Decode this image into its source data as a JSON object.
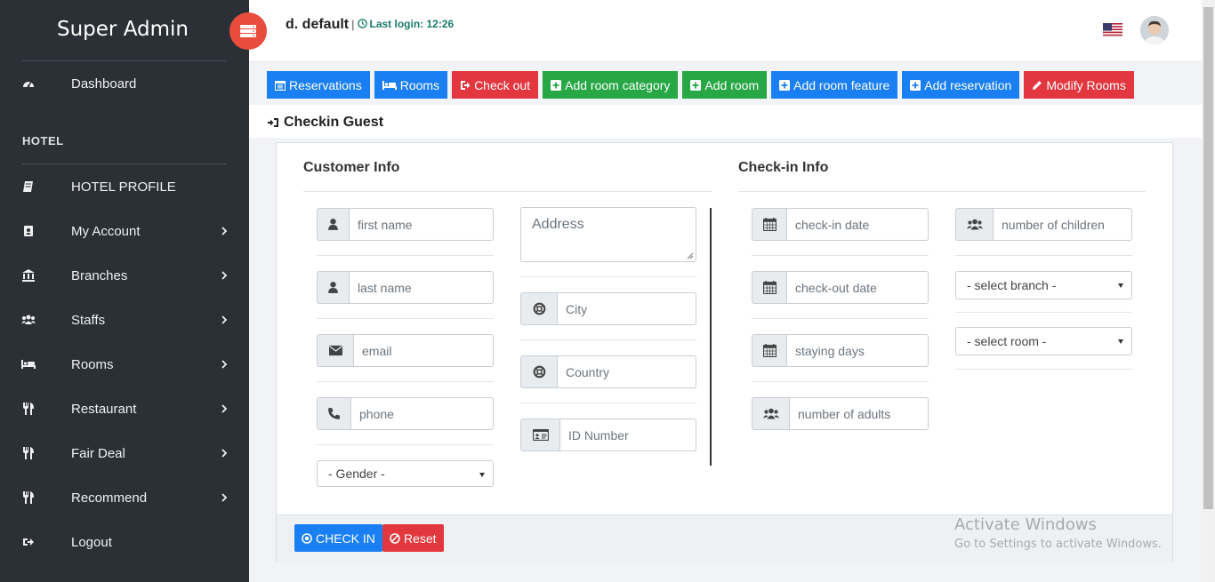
{
  "sidebar": {
    "brand": "Super Admin",
    "section_label": "HOTEL",
    "items": [
      {
        "label": "Dashboard"
      },
      {
        "label": "HOTEL PROFILE"
      },
      {
        "label": "My Account"
      },
      {
        "label": "Branches"
      },
      {
        "label": "Staffs"
      },
      {
        "label": "Rooms"
      },
      {
        "label": "Restaurant"
      },
      {
        "label": "Fair Deal"
      },
      {
        "label": "Recommend"
      },
      {
        "label": "Logout"
      }
    ]
  },
  "header": {
    "user_name": "d. default",
    "separator": "|",
    "last_login": "Last login: 12:26"
  },
  "toolbar": {
    "buttons": [
      {
        "label": "Reservations",
        "icon": "calendar-icon",
        "color": "#1a7ff3"
      },
      {
        "label": "Rooms",
        "icon": "bed-icon",
        "color": "#1a7ff3"
      },
      {
        "label": "Check out",
        "icon": "sign-out-icon",
        "color": "#e3373f"
      },
      {
        "label": "Add room category",
        "icon": "plus-square-icon",
        "color": "#27a745"
      },
      {
        "label": "Add room",
        "icon": "plus-square-icon",
        "color": "#27a745"
      },
      {
        "label": "Add room feature",
        "icon": "plus-square-icon",
        "color": "#1a7ff3"
      },
      {
        "label": "Add reservation",
        "icon": "plus-square-icon",
        "color": "#1a7ff3"
      },
      {
        "label": "Modify Rooms",
        "icon": "pencil-icon",
        "color": "#e3373f"
      }
    ]
  },
  "section": {
    "title": "Checkin Guest"
  },
  "form": {
    "customer_title": "Customer Info",
    "checkin_title": "Check-in Info",
    "customer": {
      "first_name_placeholder": "first name",
      "last_name_placeholder": "last name",
      "email_placeholder": "email",
      "phone_placeholder": "phone",
      "gender_selected": "- Gender -",
      "address_placeholder": "Address",
      "city_placeholder": "City",
      "country_placeholder": "Country",
      "id_number_placeholder": "ID Number"
    },
    "checkin": {
      "checkin_date_placeholder": "check-in date",
      "checkout_date_placeholder": "check-out date",
      "staying_days_placeholder": "staying days",
      "adults_placeholder": "number of adults",
      "children_placeholder": "number of children",
      "branch_selected": "- select branch -",
      "room_selected": "- select room -"
    }
  },
  "actions": {
    "checkin_label": "CHECK IN",
    "reset_label": "Reset"
  },
  "watermark": {
    "title": "Activate Windows",
    "subtitle": "Go to Settings to activate Windows."
  },
  "colors": {
    "sidebar_bg": "#2a3036",
    "primary": "#1a7ff3",
    "danger": "#e3373f",
    "success": "#27a745",
    "toggle": "#e84c3d",
    "last_login_text": "#1a7a6a"
  }
}
